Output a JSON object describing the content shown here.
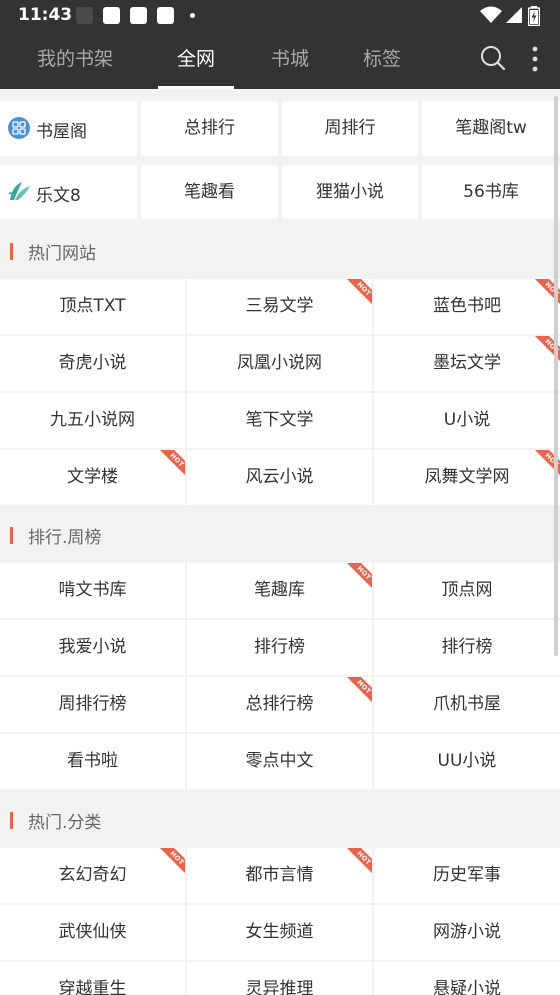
{
  "status": {
    "time": "11:43"
  },
  "tabs": [
    "我的书架",
    "全网",
    "书城",
    "标签"
  ],
  "active_tab": 1,
  "quick_links_row1": [
    "书屋阁",
    "总排行",
    "周排行",
    "笔趣阁tw"
  ],
  "quick_links_row2": [
    "乐文8",
    "笔趣看",
    "狸猫小说",
    "56书库"
  ],
  "hot_badge": "HOT",
  "sections": [
    {
      "title": "热门网站",
      "items": [
        {
          "label": "顶点TXT",
          "hot": false
        },
        {
          "label": "三易文学",
          "hot": true
        },
        {
          "label": "蓝色书吧",
          "hot": true
        },
        {
          "label": "奇虎小说",
          "hot": false
        },
        {
          "label": "凤凰小说网",
          "hot": false
        },
        {
          "label": "墨坛文学",
          "hot": true
        },
        {
          "label": "九五小说网",
          "hot": false
        },
        {
          "label": "笔下文学",
          "hot": false
        },
        {
          "label": "U小说",
          "hot": false
        },
        {
          "label": "文学楼",
          "hot": true
        },
        {
          "label": "风云小说",
          "hot": false
        },
        {
          "label": "凤舞文学网",
          "hot": true
        }
      ]
    },
    {
      "title": "排行.周榜",
      "items": [
        {
          "label": "啃文书库",
          "hot": false
        },
        {
          "label": "笔趣库",
          "hot": true
        },
        {
          "label": "顶点网",
          "hot": false
        },
        {
          "label": "我爱小说",
          "hot": false
        },
        {
          "label": "排行榜",
          "hot": false
        },
        {
          "label": "排行榜",
          "hot": false
        },
        {
          "label": "周排行榜",
          "hot": false
        },
        {
          "label": "总排行榜",
          "hot": true
        },
        {
          "label": "爪机书屋",
          "hot": false
        },
        {
          "label": "看书啦",
          "hot": false
        },
        {
          "label": "零点中文",
          "hot": false
        },
        {
          "label": "UU小说",
          "hot": false
        }
      ]
    },
    {
      "title": "热门.分类",
      "items": [
        {
          "label": "玄幻奇幻",
          "hot": true
        },
        {
          "label": "都市言情",
          "hot": true
        },
        {
          "label": "历史军事",
          "hot": false
        },
        {
          "label": "武侠仙侠",
          "hot": false
        },
        {
          "label": "女生频道",
          "hot": false
        },
        {
          "label": "网游小说",
          "hot": false
        },
        {
          "label": "穿越重生",
          "hot": false
        },
        {
          "label": "灵异推理",
          "hot": false
        },
        {
          "label": "悬疑小说",
          "hot": false
        }
      ]
    }
  ],
  "colors": {
    "appbar": "#333333",
    "accent": "#e8654d",
    "icon_blue": "#4a90d9",
    "icon_teal": "#3aa6a0"
  },
  "icons": {
    "search": "search-icon",
    "more": "more-vertical-icon"
  }
}
